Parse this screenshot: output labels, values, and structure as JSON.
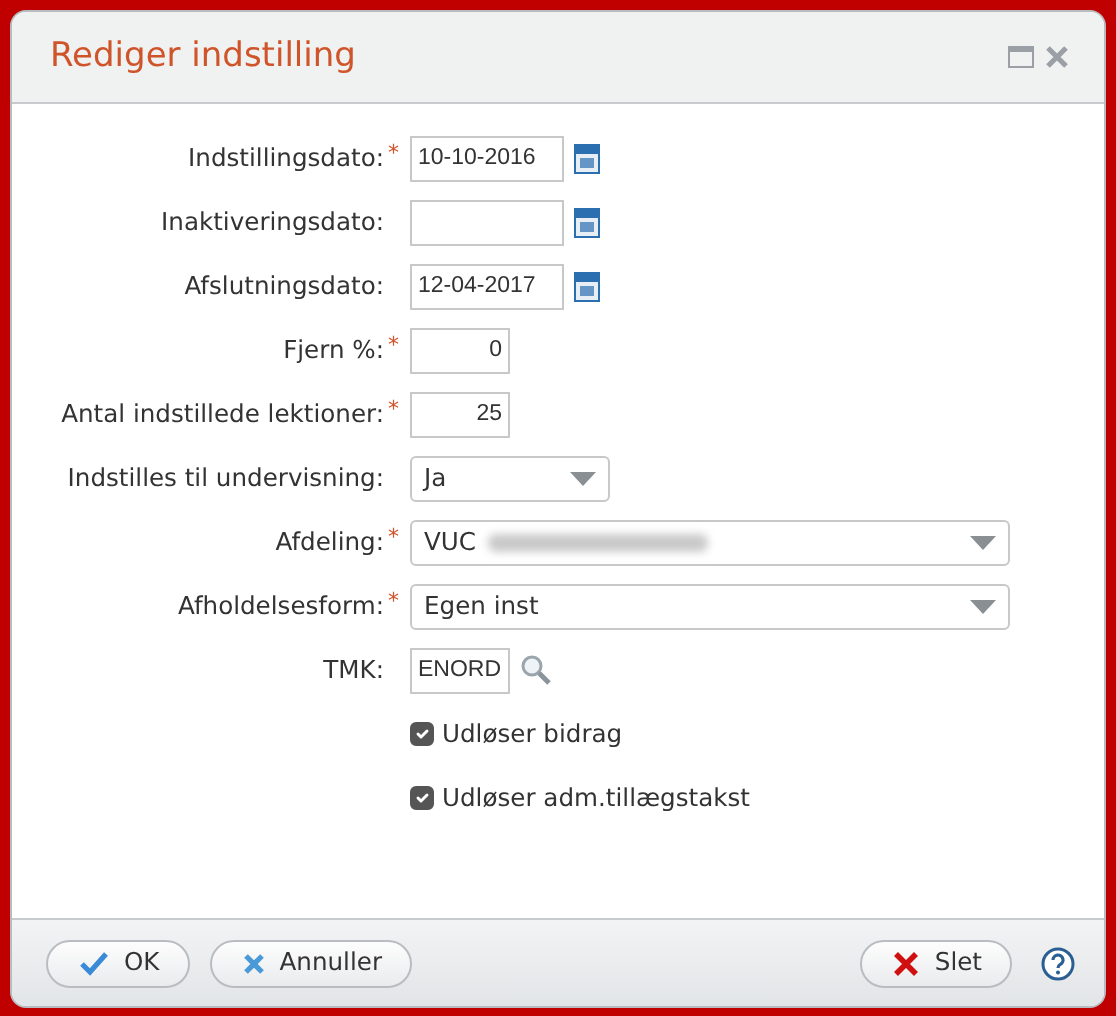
{
  "window": {
    "title": "Rediger indstilling"
  },
  "fields": [
    {
      "kind": "date",
      "label": "Indstillingsdato:",
      "mark": "*",
      "value": "10-10-2016"
    },
    {
      "kind": "date",
      "label": "Inaktiveringsdato:"
    },
    {
      "kind": "date",
      "label": "Afslutningsdato:",
      "value": "12-04-2017"
    },
    {
      "kind": "number",
      "label": "Fjern %:",
      "mark": "*",
      "value": "0"
    },
    {
      "kind": "number",
      "label": "Antal indstillede lektioner:",
      "mark": "*",
      "value": "25"
    },
    {
      "kind": "select-short",
      "label": "Indstilles til undervisning:",
      "value": "Ja"
    },
    {
      "kind": "select-wide",
      "label": "Afdeling:",
      "mark": "*",
      "value": "VUC",
      "redacted": true
    },
    {
      "kind": "select-wide",
      "label": "Afholdelsesform:",
      "mark": "*",
      "value": "Egen inst"
    },
    {
      "kind": "lookup",
      "label": "TMK:",
      "value": "ENORD"
    },
    {
      "kind": "checkbox",
      "label": "Udløser bidrag",
      "checked": true
    },
    {
      "kind": "checkbox",
      "label": "Udløser adm.tillægstakst",
      "checked": true
    }
  ],
  "buttons": [
    {
      "kind": "ok",
      "label": "OK"
    },
    {
      "kind": "cancel",
      "label": "Annuller"
    },
    {
      "kind": "delete",
      "label": "Slet"
    }
  ]
}
